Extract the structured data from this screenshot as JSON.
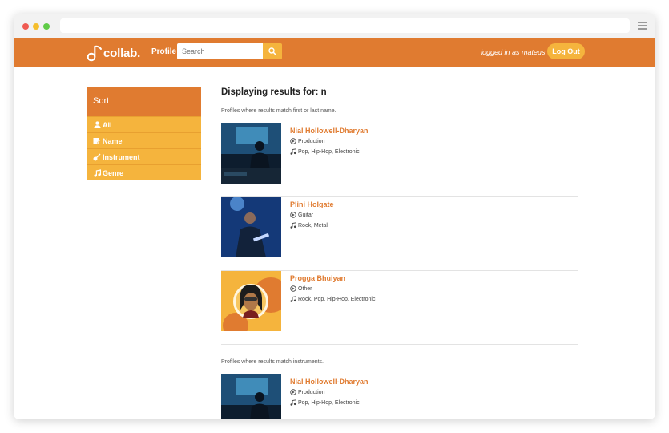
{
  "navbar": {
    "logo_text": "collab.",
    "profile_link": "Profile",
    "search_placeholder": "Search",
    "logged_in_text": "logged in as mateus",
    "logout_label": "Log Out"
  },
  "sidebar": {
    "title": "Sort",
    "items": [
      {
        "label": "All",
        "icon": "user-icon"
      },
      {
        "label": "Name",
        "icon": "id-card-icon"
      },
      {
        "label": "Instrument",
        "icon": "guitar-icon"
      },
      {
        "label": "Genre",
        "icon": "music-note-icon"
      }
    ]
  },
  "main": {
    "heading": "Displaying results for: n",
    "sections": [
      {
        "note": "Profiles where results match first or last name.",
        "results": [
          {
            "name": "Nial Hollowell-Dharyan",
            "role": "Production",
            "genres": "Pop, Hip-Hop, Electronic"
          },
          {
            "name": "Plini Holgate",
            "role": "Guitar",
            "genres": "Rock, Metal"
          },
          {
            "name": "Progga Bhuiyan",
            "role": "Other",
            "genres": "Rock, Pop, Hip-Hop, Electronic"
          }
        ]
      },
      {
        "note": "Profiles where results match instruments.",
        "results": [
          {
            "name": "Nial Hollowell-Dharyan",
            "role": "Production",
            "genres": "Pop, Hip-Hop, Electronic"
          }
        ]
      }
    ]
  },
  "colors": {
    "brand_orange": "#e07b30",
    "accent_yellow": "#f5b43d"
  }
}
